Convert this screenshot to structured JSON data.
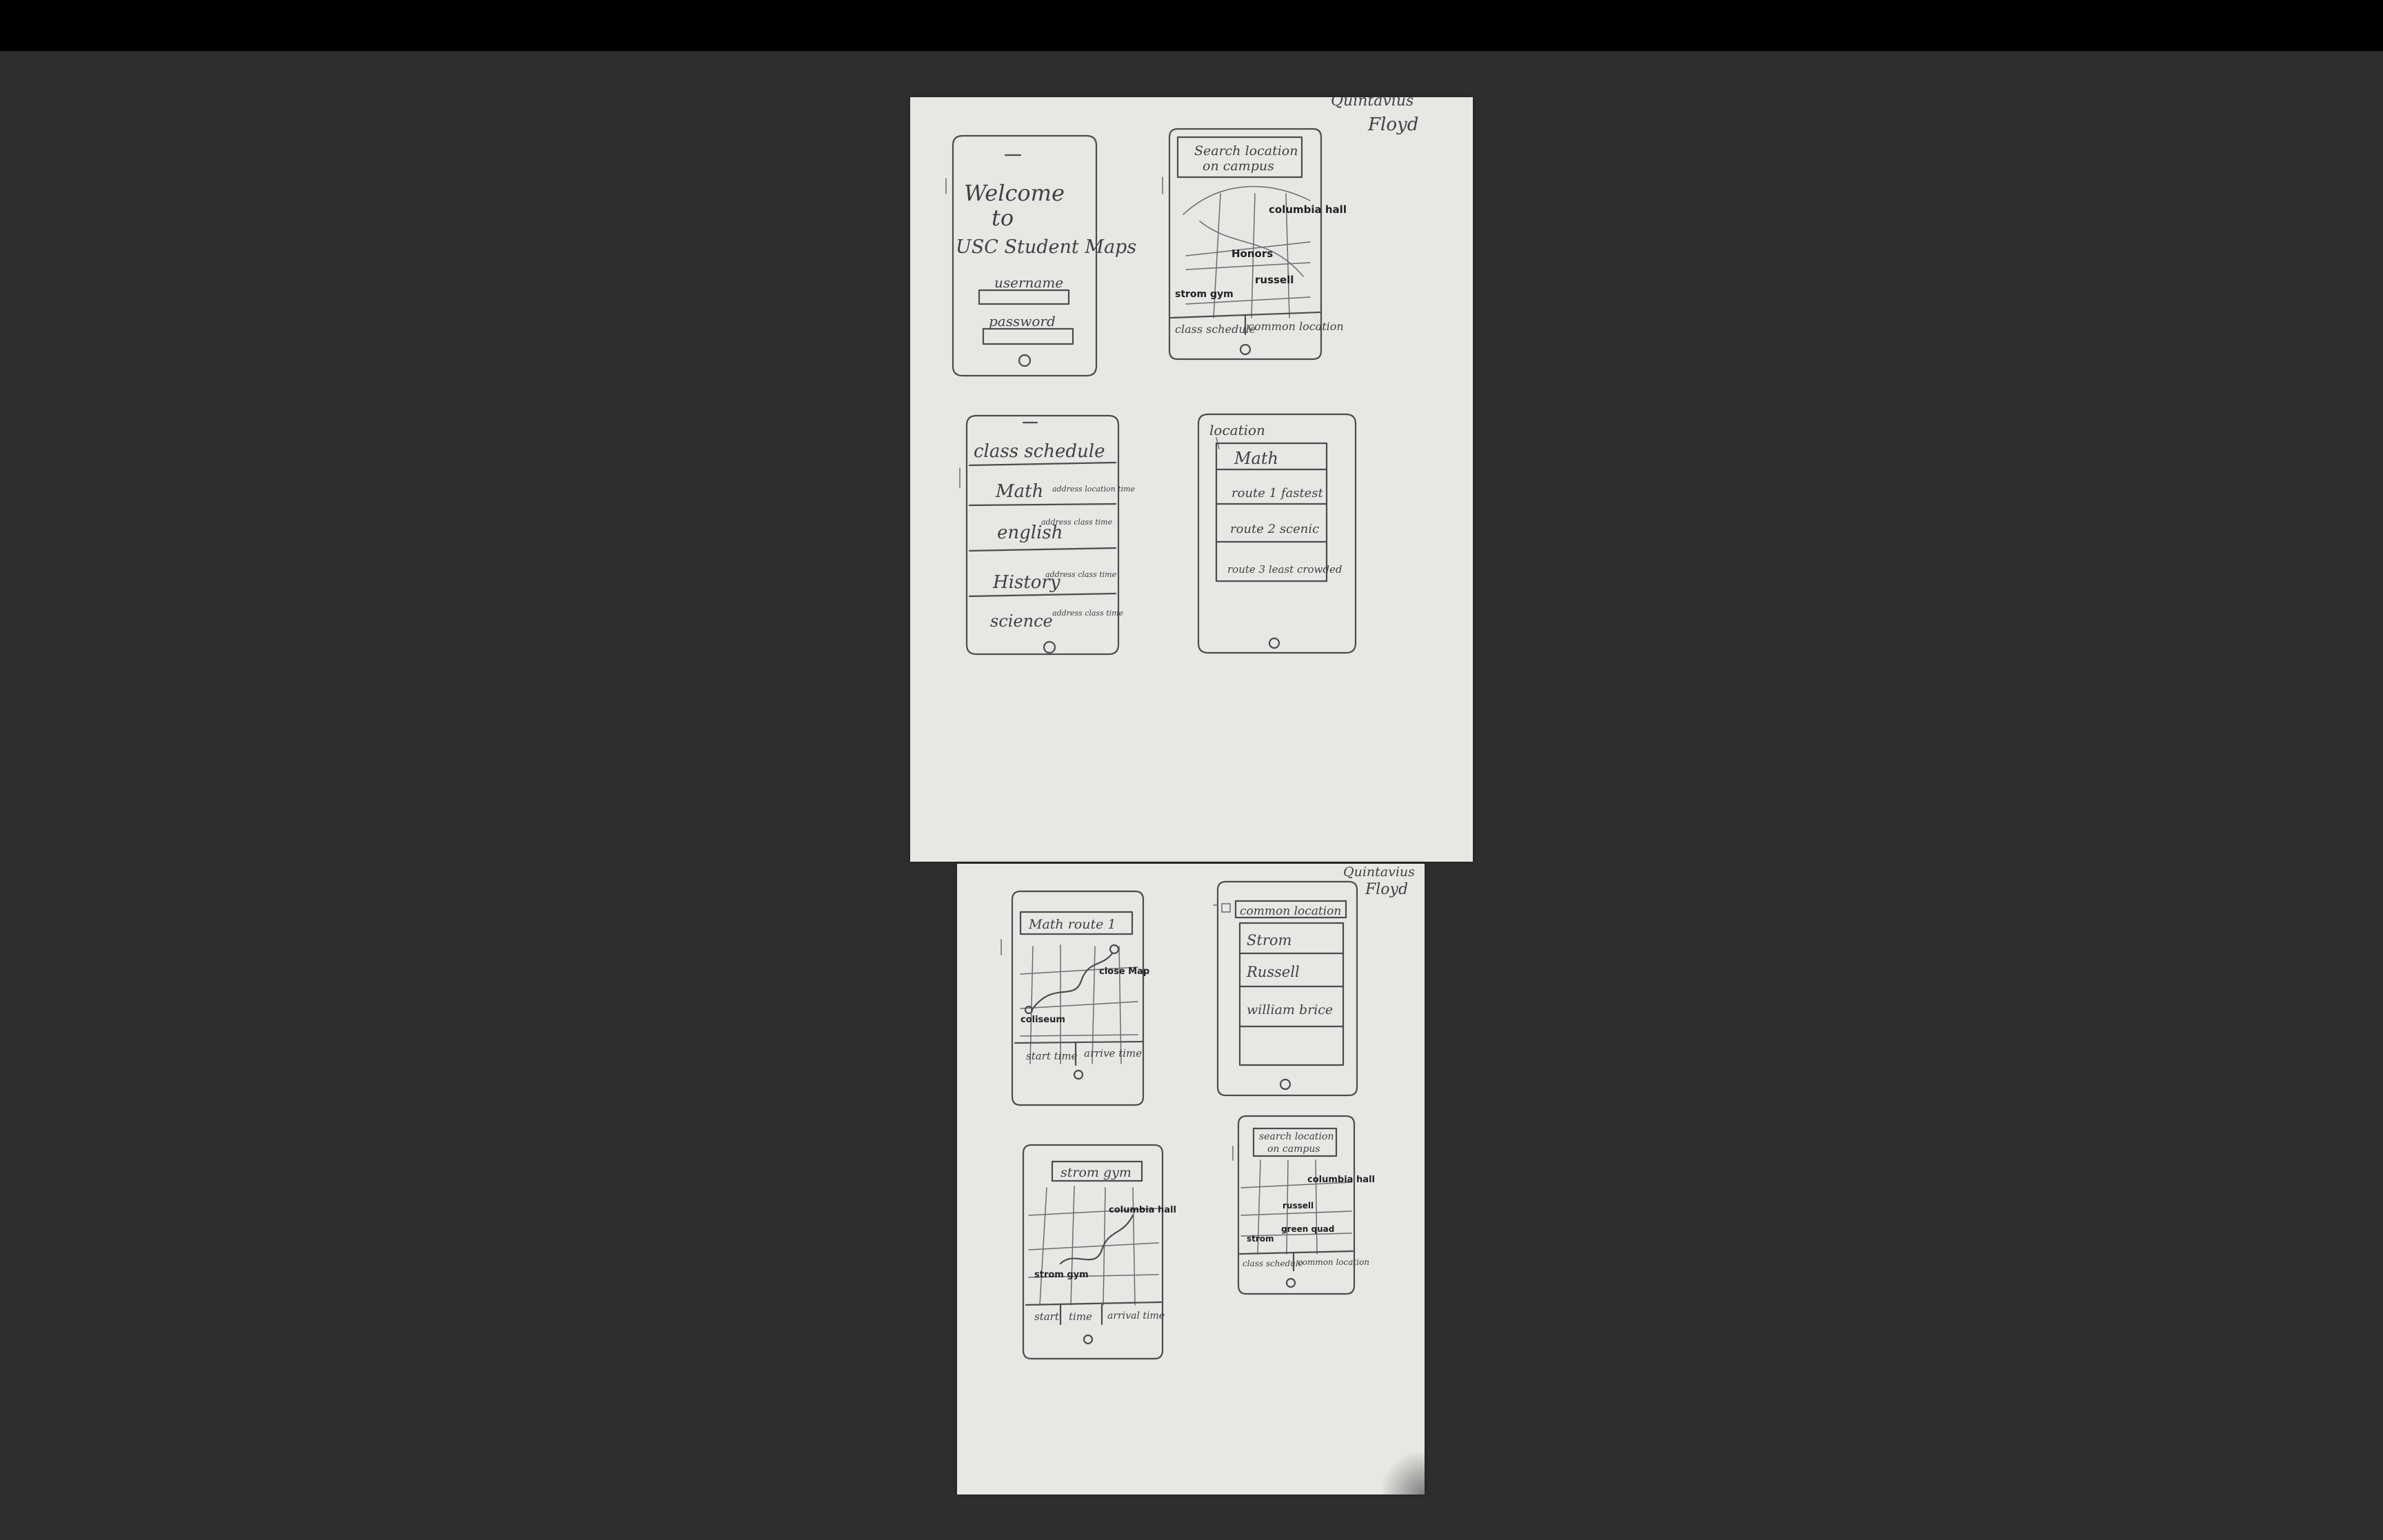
{
  "author": [
    "Quintavius",
    "Floyd"
  ],
  "sheet1": {
    "login": {
      "title": [
        "Welcome",
        "to",
        "USC Student Maps"
      ],
      "username_label": "username",
      "password_label": "password"
    },
    "map_home": {
      "search": [
        "Search location",
        "on campus"
      ],
      "labels": [
        "columbia hall",
        "Honors",
        "strom gym",
        "russell"
      ],
      "tabs": [
        "class schedule",
        "common location"
      ]
    },
    "schedule": {
      "title": "class schedule",
      "classes": [
        {
          "name": "Math",
          "detail": "address location time"
        },
        {
          "name": "english",
          "detail": "address class time"
        },
        {
          "name": "History",
          "detail": "address class time"
        },
        {
          "name": "science",
          "detail": "address class time"
        }
      ]
    },
    "location": {
      "title": "location",
      "items": [
        "Math",
        "route 1 fastest",
        "route 2 scenic",
        "route 3 least crowded"
      ]
    }
  },
  "sheet2": {
    "route_map": {
      "search": "Math route 1",
      "labels": [
        "close Map",
        "coliseum"
      ],
      "tabs": [
        "start time",
        "arrive time"
      ]
    },
    "common": {
      "title": "common location",
      "items": [
        "Strom",
        "Russell",
        "william brice"
      ]
    },
    "strom_map": {
      "search": "strom gym",
      "labels": [
        "columbia hall",
        "strom gym"
      ],
      "tabs": [
        "start",
        "time",
        "arrival time"
      ]
    },
    "map_final": {
      "search": [
        "search location",
        "on campus"
      ],
      "labels": [
        "columbia hall",
        "russell",
        "strom",
        "green quad"
      ],
      "tabs": [
        "class schedule",
        "common location"
      ]
    }
  }
}
